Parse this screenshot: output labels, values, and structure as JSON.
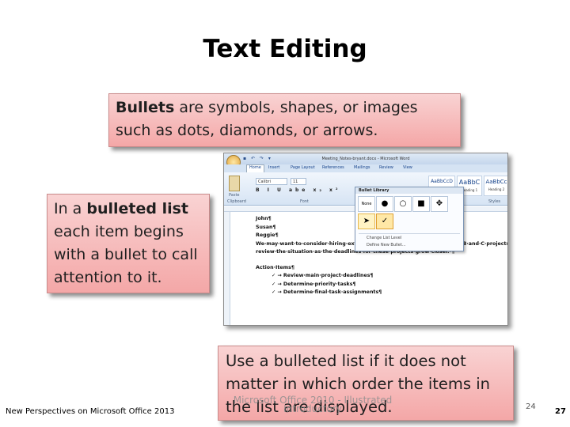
{
  "slide": {
    "title": "Text Editing"
  },
  "callouts": {
    "bullets_bold": "Bullets",
    "bullets_rest": " are symbols, shapes, or images such as dots, diamonds, or arrows.",
    "list_pre": "In a ",
    "list_bold": "bulleted list",
    "list_rest": " each item begins with a bullet to call attention to it.",
    "usage": "Use a bulleted list if it does not matter in which order the items in the list are displayed."
  },
  "word": {
    "window_title": "Meeting_Notes-bryant.docx - Microsoft Word",
    "qat": "▪ ↶ ↷ ▾",
    "tabs": [
      "Home",
      "Insert",
      "Page Layout",
      "References",
      "Mailings",
      "Review",
      "View"
    ],
    "font_name": "Calibri",
    "font_size": "11",
    "format_buttons": "B I U abe x₂ x²",
    "groups": {
      "clipboard": "Clipboard",
      "font": "Font",
      "styles": "Styles",
      "paste": "Paste"
    },
    "styles": [
      {
        "sample": "AaBbCcD",
        "name": ""
      },
      {
        "sample": "AaBbC",
        "name": "Heading 1"
      },
      {
        "sample": "AaBbCc",
        "name": "Heading 2"
      }
    ],
    "doc_lines": [
      "John¶",
      "Susan¶",
      "Reggie¶",
      "We·may·want·to·consider·hiring·extra·people·to·help·complete·the·Team·B·and·C·projects.",
      "review·the·situation·as·the·deadlines·for·these·projects·grow·closer.·¶",
      "Action·Items¶"
    ],
    "doc_bullets": [
      "✓ → Review·main·project·deadlines¶",
      "✓ → Determine·priority·tasks¶",
      "✓ → Determine·final·task·assignments¶"
    ],
    "bullet_library": {
      "header": "Bullet Library",
      "cells": [
        "None",
        "●",
        "○",
        "■",
        "✥",
        "➤",
        "✓"
      ],
      "links": [
        "Change List Level",
        "Define New Bullet..."
      ]
    }
  },
  "footer": {
    "left": "New Perspectives on Microsoft Office 2013",
    "watermark_line1": "Microsoft Office 2010 - Illustrated",
    "watermark_line2": "Introductory",
    "page_small": "24",
    "page_number": "27"
  }
}
